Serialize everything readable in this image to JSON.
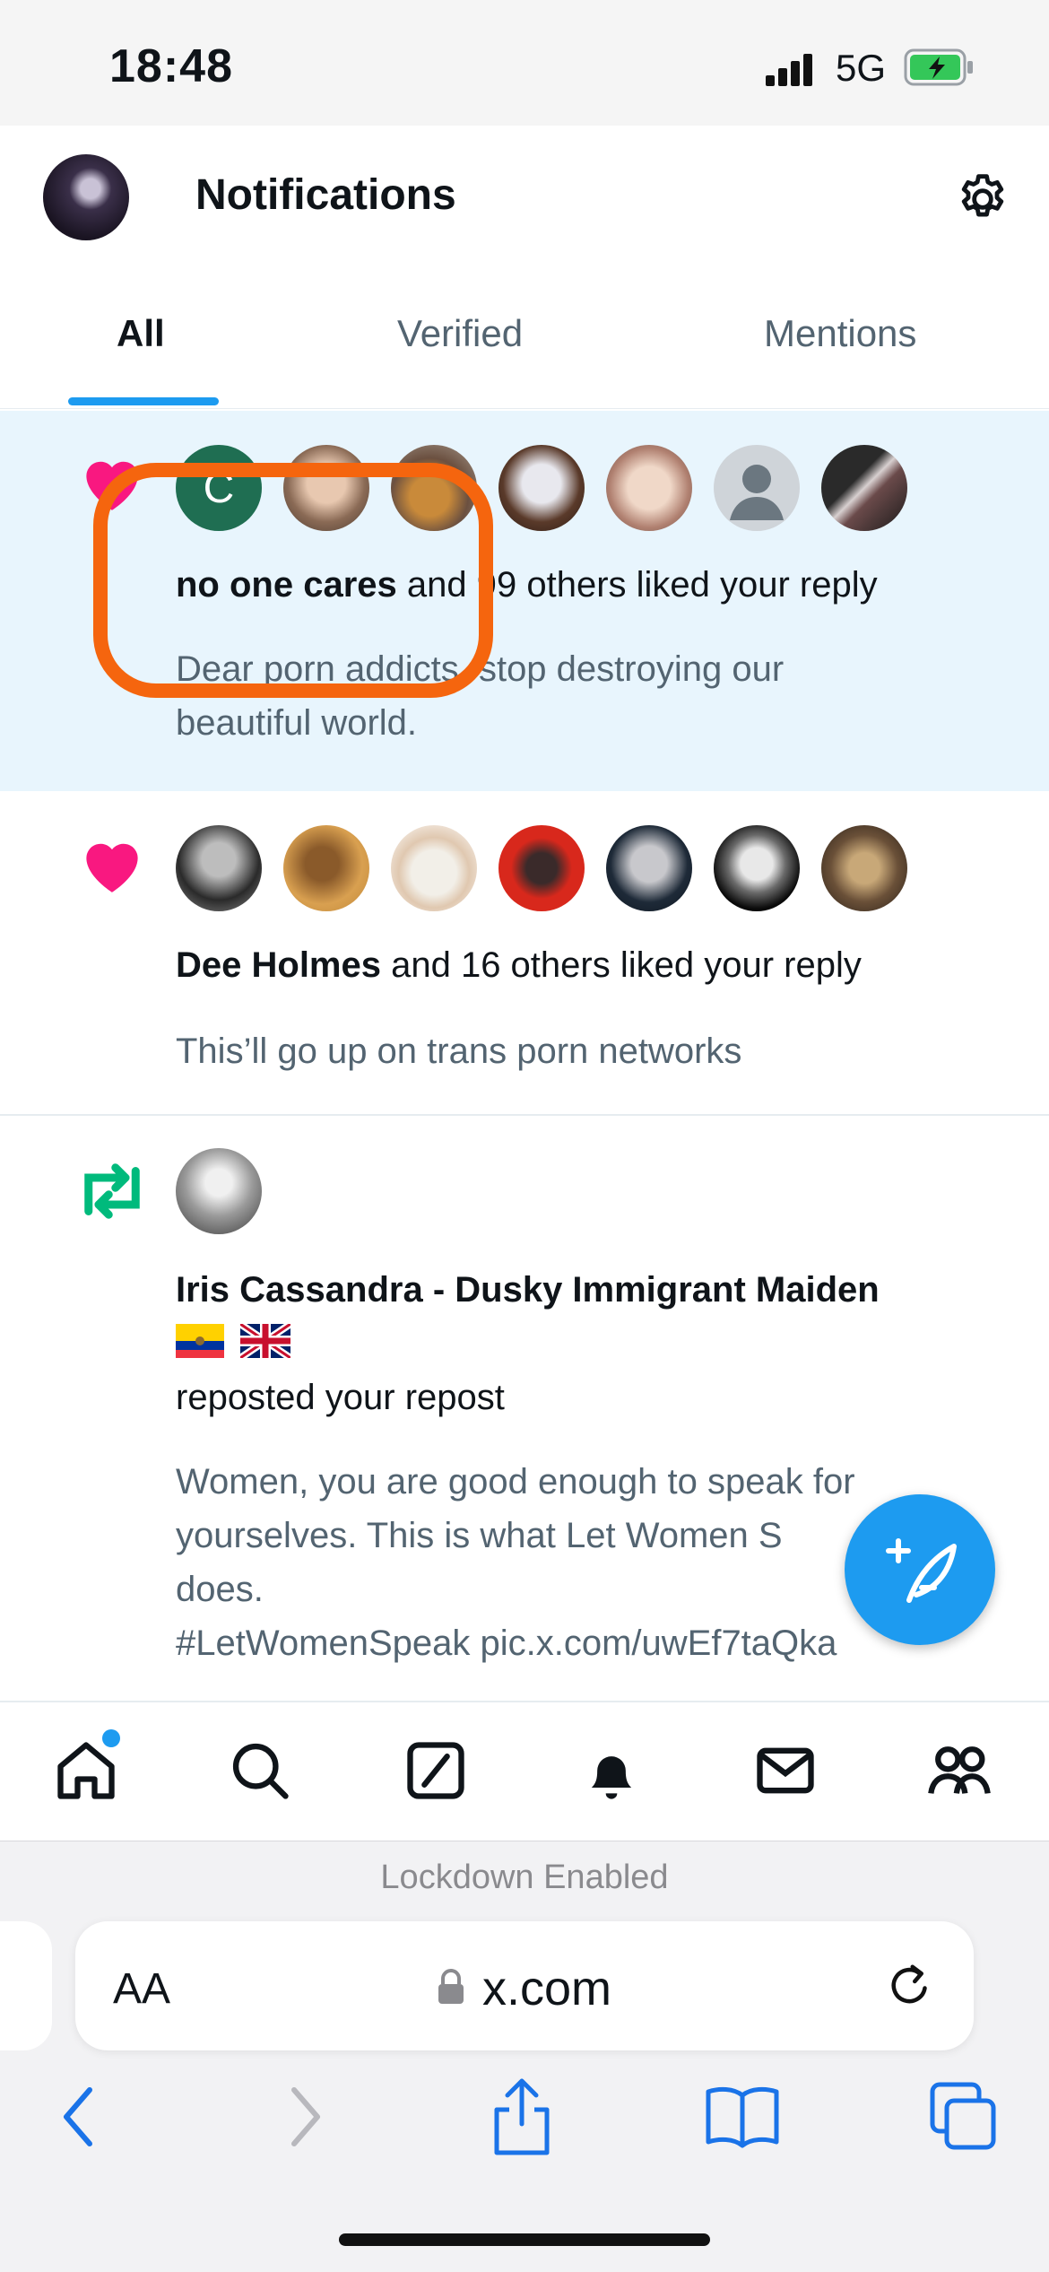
{
  "status_bar": {
    "time": "18:48",
    "network": "5G"
  },
  "header": {
    "title": "Notifications"
  },
  "tabs": [
    {
      "label": "All"
    },
    {
      "label": "Verified"
    },
    {
      "label": "Mentions"
    }
  ],
  "notifications": [
    {
      "type": "like",
      "actor": "no one cares",
      "rest": " and 99 others liked your reply",
      "avatar_initial": "C",
      "text_line1": "Dear porn addicts, stop destroying our",
      "text_line2": "beautiful world."
    },
    {
      "type": "like",
      "actor": "Dee Holmes",
      "rest": " and 16 others liked your reply",
      "text_line1": "This’ll go up on trans porn networks"
    },
    {
      "type": "repost",
      "actor": "Iris Cassandra - Dusky Immigrant Maiden",
      "action": "reposted your repost",
      "text_line1": "Women, you are good enough to speak for",
      "text_line2": "yourselves. This is what Let Women S",
      "text_line3": "does.",
      "text_line4": "#LetWomenSpeak pic.x.com/uwEf7taQka"
    }
  ],
  "browser": {
    "lockdown_text": "Lockdown Enabled",
    "text_size_label": "AA",
    "url": "x.com"
  },
  "colors": {
    "accent": "#1d9bf0",
    "like": "#f91880",
    "repost": "#00ba7c",
    "highlight": "#f5650e"
  }
}
